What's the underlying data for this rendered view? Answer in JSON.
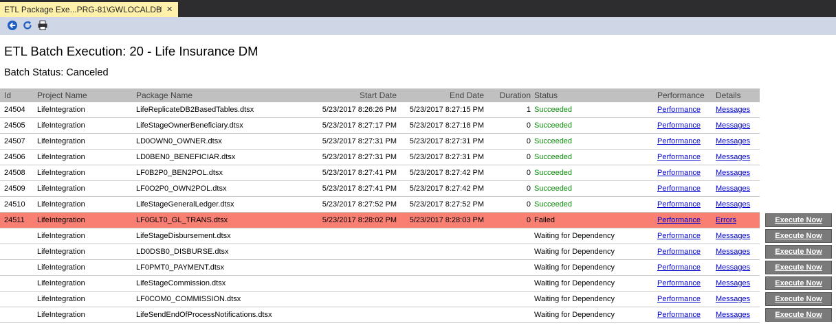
{
  "tab": {
    "title": "ETL Package Exe...PRG-81\\GWLOCALDB",
    "pin_glyph": "⊣",
    "close_glyph": "✕"
  },
  "toolbar": {
    "icons": [
      "back-icon",
      "refresh-icon",
      "print-icon"
    ]
  },
  "page": {
    "title": "ETL Batch Execution: 20 - Life Insurance DM",
    "batch_status": "Batch Status: Canceled"
  },
  "colors": {
    "tab_bg": "#fff1a9",
    "failed_row": "#f97f73",
    "succeeded": "#0a8a0a",
    "link": "#0000cc",
    "execute_btn": "#7a7a7a"
  },
  "table": {
    "headers": {
      "id": "Id",
      "project": "Project Name",
      "package": "Package Name",
      "start": "Start Date",
      "end": "End Date",
      "duration": "Duration",
      "status": "Status",
      "performance": "Performance",
      "details": "Details"
    },
    "rows": [
      {
        "id": "24504",
        "project": "LifeIntegration",
        "package": "LifeReplicateDB2BasedTables.dtsx",
        "start": "5/23/2017 8:26:26 PM",
        "end": "5/23/2017 8:27:15 PM",
        "duration": "1",
        "status": "Succeeded",
        "performance": "Performance",
        "details": "Messages",
        "execute": ""
      },
      {
        "id": "24505",
        "project": "LifeIntegration",
        "package": "LifeStageOwnerBeneficiary.dtsx",
        "start": "5/23/2017 8:27:17 PM",
        "end": "5/23/2017 8:27:18 PM",
        "duration": "0",
        "status": "Succeeded",
        "performance": "Performance",
        "details": "Messages",
        "execute": ""
      },
      {
        "id": "24507",
        "project": "LifeIntegration",
        "package": "LD0OWN0_OWNER.dtsx",
        "start": "5/23/2017 8:27:31 PM",
        "end": "5/23/2017 8:27:31 PM",
        "duration": "0",
        "status": "Succeeded",
        "performance": "Performance",
        "details": "Messages",
        "execute": ""
      },
      {
        "id": "24506",
        "project": "LifeIntegration",
        "package": "LD0BEN0_BENEFICIAR.dtsx",
        "start": "5/23/2017 8:27:31 PM",
        "end": "5/23/2017 8:27:31 PM",
        "duration": "0",
        "status": "Succeeded",
        "performance": "Performance",
        "details": "Messages",
        "execute": ""
      },
      {
        "id": "24508",
        "project": "LifeIntegration",
        "package": "LF0B2P0_BEN2POL.dtsx",
        "start": "5/23/2017 8:27:41 PM",
        "end": "5/23/2017 8:27:42 PM",
        "duration": "0",
        "status": "Succeeded",
        "performance": "Performance",
        "details": "Messages",
        "execute": ""
      },
      {
        "id": "24509",
        "project": "LifeIntegration",
        "package": "LF0O2P0_OWN2POL.dtsx",
        "start": "5/23/2017 8:27:41 PM",
        "end": "5/23/2017 8:27:42 PM",
        "duration": "0",
        "status": "Succeeded",
        "performance": "Performance",
        "details": "Messages",
        "execute": ""
      },
      {
        "id": "24510",
        "project": "LifeIntegration",
        "package": "LifeStageGeneralLedger.dtsx",
        "start": "5/23/2017 8:27:52 PM",
        "end": "5/23/2017 8:27:52 PM",
        "duration": "0",
        "status": "Succeeded",
        "performance": "Performance",
        "details": "Messages",
        "execute": ""
      },
      {
        "id": "24511",
        "project": "LifeIntegration",
        "package": "LF0GLT0_GL_TRANS.dtsx",
        "start": "5/23/2017 8:28:02 PM",
        "end": "5/23/2017 8:28:03 PM",
        "duration": "0",
        "status": "Failed",
        "performance": "Performance",
        "details": "Errors",
        "execute": "Execute Now"
      },
      {
        "id": "",
        "project": "LifeIntegration",
        "package": "LifeStageDisbursement.dtsx",
        "start": "",
        "end": "",
        "duration": "",
        "status": "Waiting for Dependency",
        "performance": "Performance",
        "details": "Messages",
        "execute": "Execute Now"
      },
      {
        "id": "",
        "project": "LifeIntegration",
        "package": "LD0DSB0_DISBURSE.dtsx",
        "start": "",
        "end": "",
        "duration": "",
        "status": "Waiting for Dependency",
        "performance": "Performance",
        "details": "Messages",
        "execute": "Execute Now"
      },
      {
        "id": "",
        "project": "LifeIntegration",
        "package": "LF0PMT0_PAYMENT.dtsx",
        "start": "",
        "end": "",
        "duration": "",
        "status": "Waiting for Dependency",
        "performance": "Performance",
        "details": "Messages",
        "execute": "Execute Now"
      },
      {
        "id": "",
        "project": "LifeIntegration",
        "package": "LifeStageCommission.dtsx",
        "start": "",
        "end": "",
        "duration": "",
        "status": "Waiting for Dependency",
        "performance": "Performance",
        "details": "Messages",
        "execute": "Execute Now"
      },
      {
        "id": "",
        "project": "LifeIntegration",
        "package": "LF0COM0_COMMISSION.dtsx",
        "start": "",
        "end": "",
        "duration": "",
        "status": "Waiting for Dependency",
        "performance": "Performance",
        "details": "Messages",
        "execute": "Execute Now"
      },
      {
        "id": "",
        "project": "LifeIntegration",
        "package": "LifeSendEndOfProcessNotifications.dtsx",
        "start": "",
        "end": "",
        "duration": "",
        "status": "Waiting for Dependency",
        "performance": "Performance",
        "details": "Messages",
        "execute": "Execute Now"
      }
    ]
  }
}
